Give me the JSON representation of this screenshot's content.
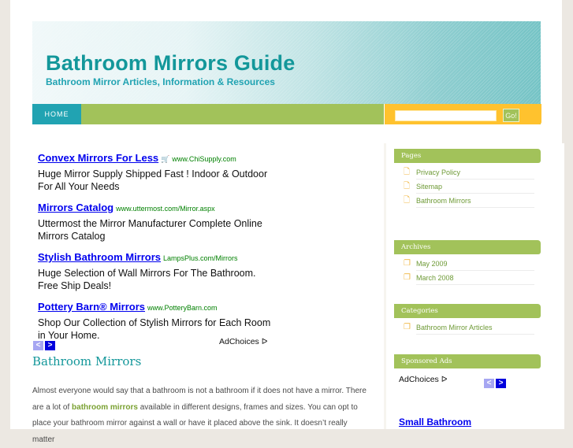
{
  "site": {
    "title": "Bathroom Mirrors Guide",
    "tagline": "Bathroom Mirror Articles, Information & Resources"
  },
  "nav": {
    "home_label": "HOME",
    "search_placeholder": "",
    "search_value": "",
    "search_button": "Go!"
  },
  "colors": {
    "teal": "#13979a",
    "nav_green": "#a2c25a",
    "search_yellow": "#ffc22e",
    "home_teal": "#21a3b2",
    "ad_link_blue": "#0000ee",
    "ad_url_green": "#008000"
  },
  "ads": [
    {
      "title": "Convex Mirrors For Less",
      "has_cart_icon": true,
      "url": "www.ChiSupply.com",
      "desc": "Huge Mirror Supply Shipped Fast ! Indoor & Outdoor For All Your Needs"
    },
    {
      "title": "Mirrors Catalog",
      "url": "www.uttermost.com/Mirror.aspx",
      "desc": "Uttermost the Mirror Manufacturer Complete Online Mirrors Catalog"
    },
    {
      "title": "Stylish Bathroom Mirrors",
      "url": "LampsPlus.com/Mirrors",
      "desc": "Huge Selection of Wall Mirrors For The Bathroom. Free Ship Deals!"
    },
    {
      "title": "Pottery Barn® Mirrors",
      "url": "www.PotteryBarn.com",
      "desc": "Shop Our Collection of Stylish Mirrors for Each Room in Your Home."
    }
  ],
  "ad_nav": {
    "prev": "<",
    "next": ">",
    "adchoices": "AdChoices",
    "adchoices_icon": "ᐅ"
  },
  "post": {
    "title": "Bathroom Mirrors",
    "body_before": "Almost everyone would say that a bathroom is not a bathroom if it does not have a mirror. There are a lot of ",
    "body_link": "bathroom mirrors",
    "body_after": " available in different designs, frames and sizes. You can opt to place your bathroom mirror against a wall or have it placed above the sink. It doesn’t really matter"
  },
  "sidebar": {
    "pages": {
      "heading": "Pages",
      "icon": "page-icon",
      "items": [
        "Privacy Policy",
        "Sitemap",
        "Bathroom Mirrors"
      ]
    },
    "archives": {
      "heading": "Archives",
      "icon": "stacked-pages-icon",
      "items": [
        "May 2009",
        "March 2008"
      ]
    },
    "categories": {
      "heading": "Categories",
      "icon": "stacked-pages-icon",
      "items": [
        "Bathroom Mirror Articles"
      ]
    },
    "sponsored": {
      "heading": "Sponsored Ads",
      "adchoices": "AdChoices",
      "first_ad_title": "Small Bathroom"
    }
  }
}
